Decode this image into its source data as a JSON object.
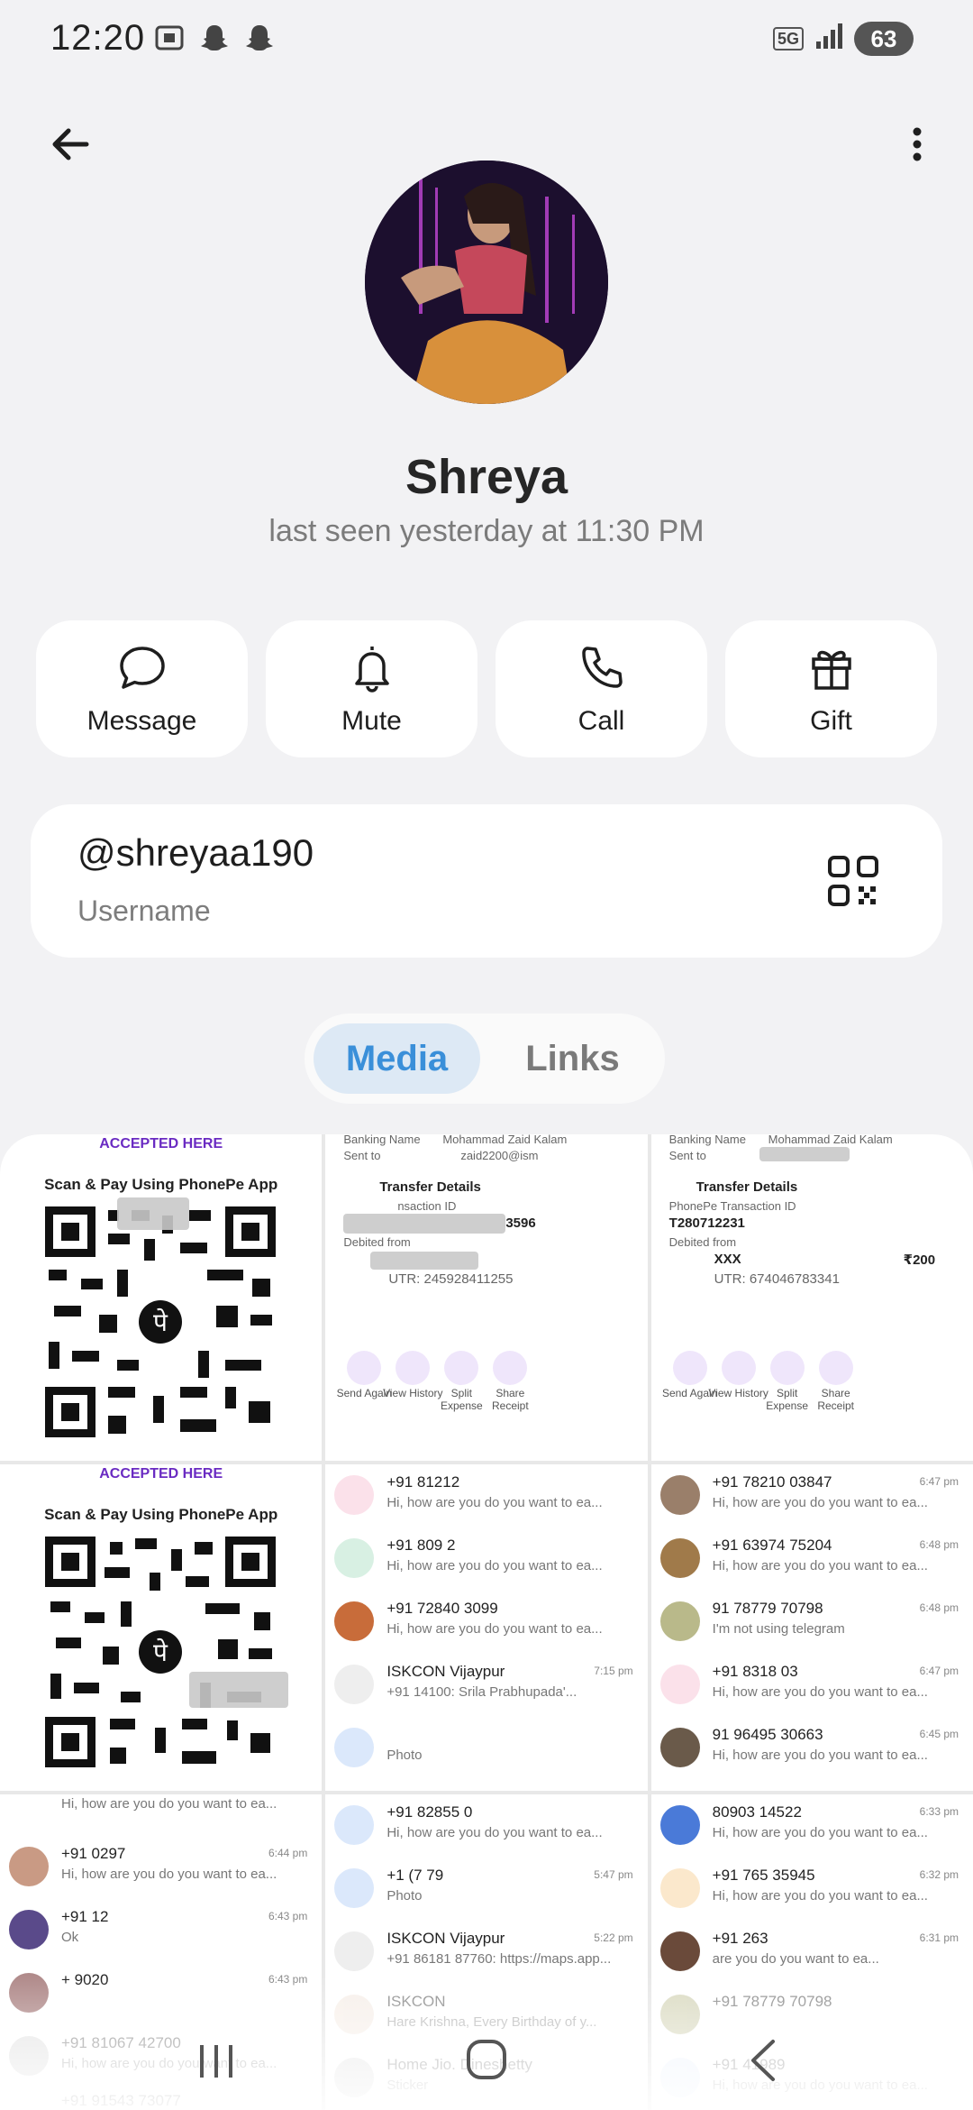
{
  "status": {
    "time": "12:20",
    "network": "5G",
    "battery": "63"
  },
  "profile": {
    "name": "Shreya",
    "last_seen": "last seen yesterday at 11:30 PM"
  },
  "actions": [
    {
      "label": "Message",
      "icon": "message-bubble-icon"
    },
    {
      "label": "Mute",
      "icon": "bell-icon"
    },
    {
      "label": "Call",
      "icon": "phone-icon"
    },
    {
      "label": "Gift",
      "icon": "gift-icon"
    }
  ],
  "username": {
    "value": "@shreyaa190",
    "caption": "Username"
  },
  "tabs": [
    {
      "label": "Media",
      "active": true
    },
    {
      "label": "Links",
      "active": false
    }
  ],
  "media": {
    "phonepe": {
      "header": "ACCEPTED HERE",
      "subtitle": "Scan & Pay Using PhonePe App"
    },
    "receipt1": {
      "banking_name": "Banking Name",
      "banking_value": "Mohammad Zaid Kalam",
      "sent_to": "Sent to",
      "sent_value": "zaid2200@ism",
      "section": "Transfer Details",
      "tx_id_label": "nsaction ID",
      "tx_id_value": "3596",
      "debited": "Debited from",
      "utr": "UTR: 245928411255",
      "actions": [
        "Send Again",
        "View History",
        "Split Expense",
        "Share Receipt"
      ]
    },
    "receipt2": {
      "banking_name": "Banking Name",
      "banking_value": "Mohammad Zaid Kalam",
      "sent_to": "Sent to",
      "section": "Transfer Details",
      "tx_id_label": "PhonePe Transaction ID",
      "tx_id_value": "T280712231",
      "debited": "Debited from",
      "account": "XXX",
      "amount": "₹200",
      "utr": "UTR: 674046783341",
      "actions": [
        "Send Again",
        "View History",
        "Split Expense",
        "Share Receipt"
      ]
    },
    "chats_mid": [
      {
        "name": "+91 81212",
        "msg": "Hi, how are you do you want to ea...",
        "time": ""
      },
      {
        "name": "+91 809 2",
        "msg": "Hi, how are you do you want to ea...",
        "time": ""
      },
      {
        "name": "+91 72840 3099",
        "msg": "Hi, how are you do you want to ea...",
        "time": ""
      },
      {
        "name": "ISKCON Vijaypur",
        "msg": "+91 14100: Srila Prabhupada'...",
        "time": "7:15 pm"
      },
      {
        "name": "",
        "msg": "Photo",
        "time": ""
      }
    ],
    "chats_right": [
      {
        "name": "+91 78210 03847",
        "msg": "Hi, how are you do you want to ea...",
        "time": "6:47 pm"
      },
      {
        "name": "+91 63974 75204",
        "msg": "Hi, how are you do you want to ea...",
        "time": "6:48 pm"
      },
      {
        "name": "91 78779 70798",
        "msg": "I'm not using telegram",
        "time": "6:48 pm"
      },
      {
        "name": "+91 8318 03",
        "msg": "Hi, how are you do you want to ea...",
        "time": "6:47 pm"
      },
      {
        "name": "91 96495 30663",
        "msg": "Hi, how are you do you want to ea...",
        "time": "6:45 pm"
      }
    ],
    "chats_bl": [
      {
        "name": "",
        "msg": "Hi, how are you do you want to ea...",
        "time": ""
      },
      {
        "name": "+91 0297",
        "msg": "Hi, how are you do you want to ea...",
        "time": "6:44 pm"
      },
      {
        "name": "+91 12",
        "msg": "Ok",
        "time": "6:43 pm"
      },
      {
        "name": "+ 9020",
        "msg": "",
        "time": "6:43 pm"
      },
      {
        "name": "+91 81067 42700",
        "msg": "Hi, how are you do you want to ea...",
        "time": ""
      },
      {
        "name": "+91 91543 73077",
        "msg": "",
        "time": ""
      }
    ],
    "chats_bm": [
      {
        "name": "+91 82855 0",
        "msg": "Hi, how are you do you want to ea...",
        "time": ""
      },
      {
        "name": "+1 (7 79",
        "msg": "Photo",
        "time": "5:47 pm"
      },
      {
        "name": "ISKCON Vijaypur",
        "msg": "+91 86181 87760: https://maps.app...",
        "time": "5:22 pm"
      },
      {
        "name": "ISKCON",
        "msg": "Hare Krishna, Every Birthday of y...",
        "time": ""
      },
      {
        "name": "Home Jio. Dineshetty",
        "msg": "Sticker",
        "time": ""
      }
    ],
    "chats_br": [
      {
        "name": "80903 14522",
        "msg": "Hi, how are you do you want to ea...",
        "time": "6:33 pm"
      },
      {
        "name": "+91 765 35945",
        "msg": "Hi, how are you do you want to ea...",
        "time": "6:32 pm"
      },
      {
        "name": "+91 263",
        "msg": "are you do you want to ea...",
        "time": "6:31 pm"
      },
      {
        "name": "+91 78779 70798",
        "msg": "",
        "time": ""
      },
      {
        "name": "+91 41989",
        "msg": "Hi, how are you do you want to ea...",
        "time": ""
      }
    ]
  }
}
